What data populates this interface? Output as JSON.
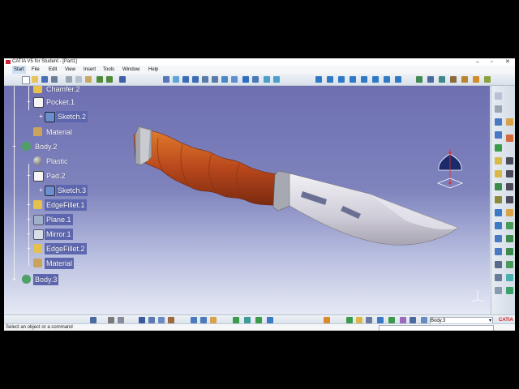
{
  "window": {
    "title": "CATIA V5 for Student - [Part1]"
  },
  "menu": [
    "Start",
    "File",
    "Edit",
    "View",
    "Insert",
    "Tools",
    "Window",
    "Help"
  ],
  "tree": [
    {
      "label": "Chamfer.2",
      "icon": "chamfer-icon"
    },
    {
      "label": "Pocket.1",
      "icon": "pocket-icon"
    },
    {
      "label": "Sketch.2",
      "icon": "sketch-icon"
    },
    {
      "label": "Material",
      "icon": "material-icon"
    },
    {
      "label": "Body.2",
      "icon": "body-icon"
    },
    {
      "label": "Plastic",
      "icon": "material-sphere-icon"
    },
    {
      "label": "Pad.2",
      "icon": "pad-icon"
    },
    {
      "label": "Sketch.3",
      "icon": "sketch-icon"
    },
    {
      "label": "EdgeFillet.1",
      "icon": "edgefillet-icon"
    },
    {
      "label": "Plane.1",
      "icon": "plane-icon"
    },
    {
      "label": "Mirror.1",
      "icon": "mirror-icon"
    },
    {
      "label": "EdgeFillet.2",
      "icon": "edgefillet-icon"
    },
    {
      "label": "Material",
      "icon": "material-icon"
    },
    {
      "label": "Body.3",
      "icon": "body-icon"
    }
  ],
  "bottom": {
    "body_selector": "Body.3"
  },
  "status": {
    "message": "Select an object or a command"
  },
  "colors": {
    "viewport_top": "#6e6fb1",
    "viewport_bottom": "#e6e9f4",
    "handle": "#b8471c",
    "blade": "#dcdce6"
  }
}
